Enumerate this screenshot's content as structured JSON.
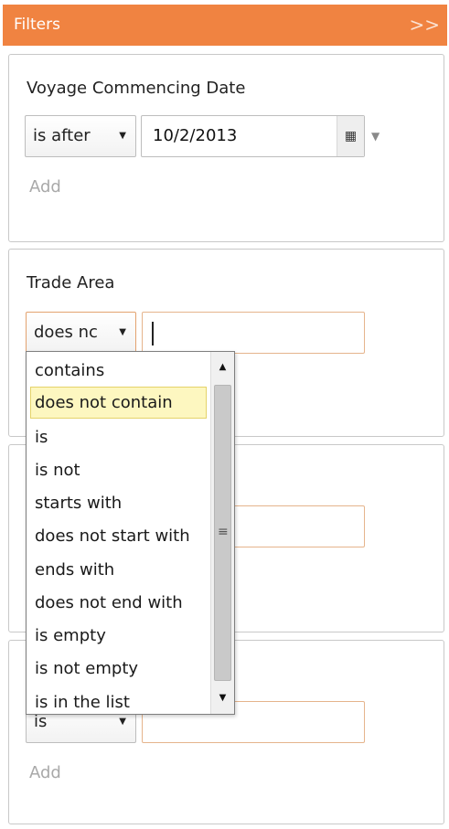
{
  "header": {
    "title": "Filters",
    "collapse_label": ">>"
  },
  "panels": [
    {
      "title": "Voyage Commencing Date",
      "operator": "is after",
      "value": "10/2/2013",
      "add_label": "Add"
    },
    {
      "title": "Trade Area",
      "operator": "does nc",
      "value": ""
    },
    {
      "value": ""
    },
    {
      "operator": "is",
      "value": "",
      "add_label": "Add"
    }
  ],
  "dropdown": {
    "selected": "does not contain",
    "options": [
      "contains",
      "does not contain",
      "is",
      "is not",
      "starts with",
      "does not start with",
      "ends with",
      "does not end with",
      "is empty",
      "is not empty",
      "is in the list"
    ]
  },
  "icons": {
    "select_arrow": "caret-down-icon",
    "calendar": "calendar-icon",
    "date_dropdown": "caret-down-icon",
    "scroll_up": "triangle-up-icon",
    "scroll_down": "triangle-down-icon"
  },
  "colors": {
    "header_bg": "#f08341",
    "selected_option_bg": "#fdf7c0",
    "active_field_border": "#e3a26f"
  }
}
